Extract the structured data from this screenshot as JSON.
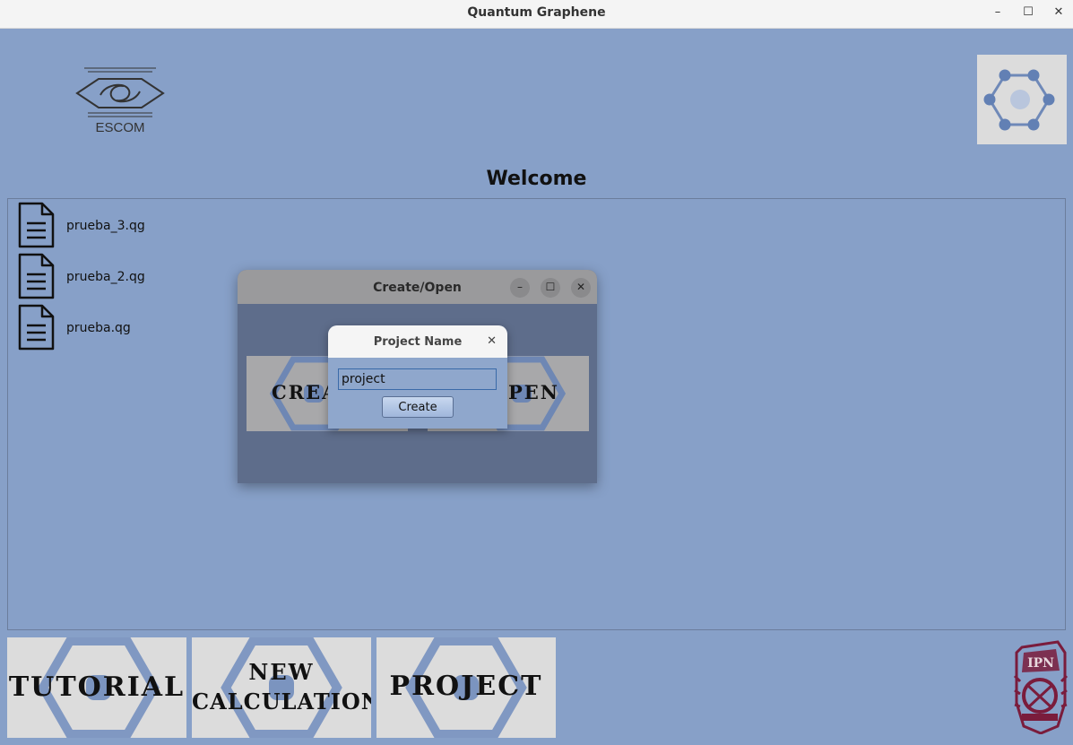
{
  "window": {
    "title": "Quantum Graphene",
    "controls": {
      "minimize": "–",
      "maximize": "☐",
      "close": "✕"
    }
  },
  "header": {
    "logo_text": "ESCOM",
    "welcome": "Welcome"
  },
  "files": [
    {
      "name": "prueba_3.qg"
    },
    {
      "name": "prueba_2.qg"
    },
    {
      "name": "prueba.qg"
    }
  ],
  "bottom_buttons": {
    "tutorial": "TUTORIAL",
    "new_calc_line1": "NEW",
    "new_calc_line2": "CALCULATION",
    "project": "PROJECT"
  },
  "dialog": {
    "title": "Create/Open",
    "create_label": "CREA",
    "open_label": "PEN",
    "controls": {
      "minimize": "–",
      "maximize": "☐",
      "close": "✕"
    }
  },
  "popup": {
    "title": "Project Name",
    "close": "✕",
    "input_value": "project",
    "button": "Create"
  },
  "icons": {
    "file": "document-icon",
    "graphene": "graphene-hexagon-icon",
    "ipn": "ipn-logo"
  },
  "colors": {
    "background": "#87a0c8",
    "hex_accent": "#6f89b8",
    "tile": "#dcdcdc",
    "ipn_maroon": "#7a1c3c"
  }
}
